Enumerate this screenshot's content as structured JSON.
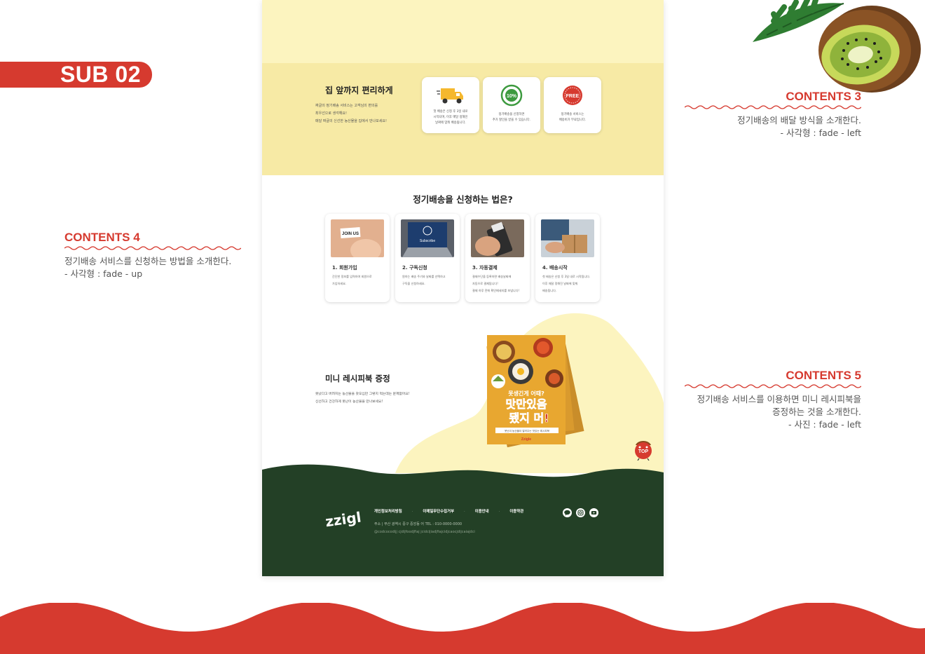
{
  "sub_tag": "SUB 02",
  "annotations": {
    "c3": {
      "title": "CONTENTS 3",
      "lines": [
        "정기배송의 배달 방식을 소개한다.",
        "- 사각형 : fade - left"
      ]
    },
    "c4": {
      "title": "CONTENTS 4",
      "lines": [
        "정기배송 서비스를 신청하는 방법을 소개한다.",
        "- 사각형 : fade - up"
      ]
    },
    "c5": {
      "title": "CONTENTS 5",
      "lines": [
        "정기배송 서비스를 이용하면 미니 레시피북을",
        "증정하는 것을 소개한다.",
        "- 사진 : fade - left"
      ]
    }
  },
  "delivery": {
    "title": "집 앞까지 편리하게",
    "desc": [
      "짜글의 정기배송 서비스는 고객님의 편의를",
      "최우선으로 생각해요!",
      "매달 짜글의 신선한 농산물을 집에서 만나보세요!"
    ],
    "cards": [
      {
        "icon": "truck-icon",
        "lines": [
          "첫 배송은 신청 후 3일 내로",
          "시작되며, 이후 매달 정해진",
          "날짜에 맞춰 배송됩니다."
        ]
      },
      {
        "icon": "discount-badge-icon",
        "badge": "10%",
        "lines": [
          "정기배송을 신청하면",
          "추가 할인을 받을 수 있습니다."
        ]
      },
      {
        "icon": "free-badge-icon",
        "badge": "FREE",
        "lines": [
          "정기배송 서비스는",
          "배송비가 무료입니다."
        ]
      }
    ]
  },
  "howto": {
    "title": "정기배송을 신청하는 법은?",
    "steps": [
      {
        "title": "1. 회원가입",
        "photo_text": "JOIN US",
        "lines": [
          "간단한 정보를 입력하여 회원으로",
          "가입하세요."
        ]
      },
      {
        "title": "2. 구독신청",
        "photo_text": "Subscribe",
        "lines": [
          "원하는 배송 주기와 날짜를 선택하고",
          "구독을 신청하세요."
        ]
      },
      {
        "title": "3. 자동결제",
        "lines": [
          "결제수단을 등록하면 배송날짜에",
          "자동으로 결제됩니다!",
          "결제 하루 전에 확인메세지를 보냅니다!"
        ]
      },
      {
        "title": "4. 배송시작",
        "lines": [
          "첫 배송은 신청 후 3일 내로 시작됩니다.",
          "이후 매달 정해진 날짜에 맞춰",
          "배송됩니다."
        ]
      }
    ]
  },
  "recipe": {
    "title": "미니 레시피북 증정",
    "desc": [
      "못났다고 버려지는 농산물을 갖오십만 그렇지 먹는데는 문제없어요!",
      "신선하고 건강하게 못난이 농산물을 만나보세요!"
    ],
    "book": {
      "top": "못생긴게 어때?",
      "main1": "맛만있음",
      "main2": "됐지 머!",
      "sub": "못난이 농산물이 알려주는 맛있는 레시피북",
      "brand": "Zzigle"
    },
    "top_button": "TOP"
  },
  "footer": {
    "logo": "zzigle",
    "links": [
      "개인정보처리방침",
      "이메일무단수집거부",
      "이용안내",
      "이용약관"
    ],
    "address": "주소 | 부산 광역시 중구 중앙동 어     TEL : 010-0000-0000",
    "email": "@codcocodijj cjdijfoodjfiaj jcidcijiadjfiajcidjcaocjdijcaiajdci",
    "sns": [
      "talk-icon",
      "instagram-icon",
      "youtube-icon"
    ]
  },
  "colors": {
    "accent": "#d63a2f",
    "cream": "#fcf4bf",
    "yellow": "#f7eaa5",
    "forest": "#234026"
  }
}
